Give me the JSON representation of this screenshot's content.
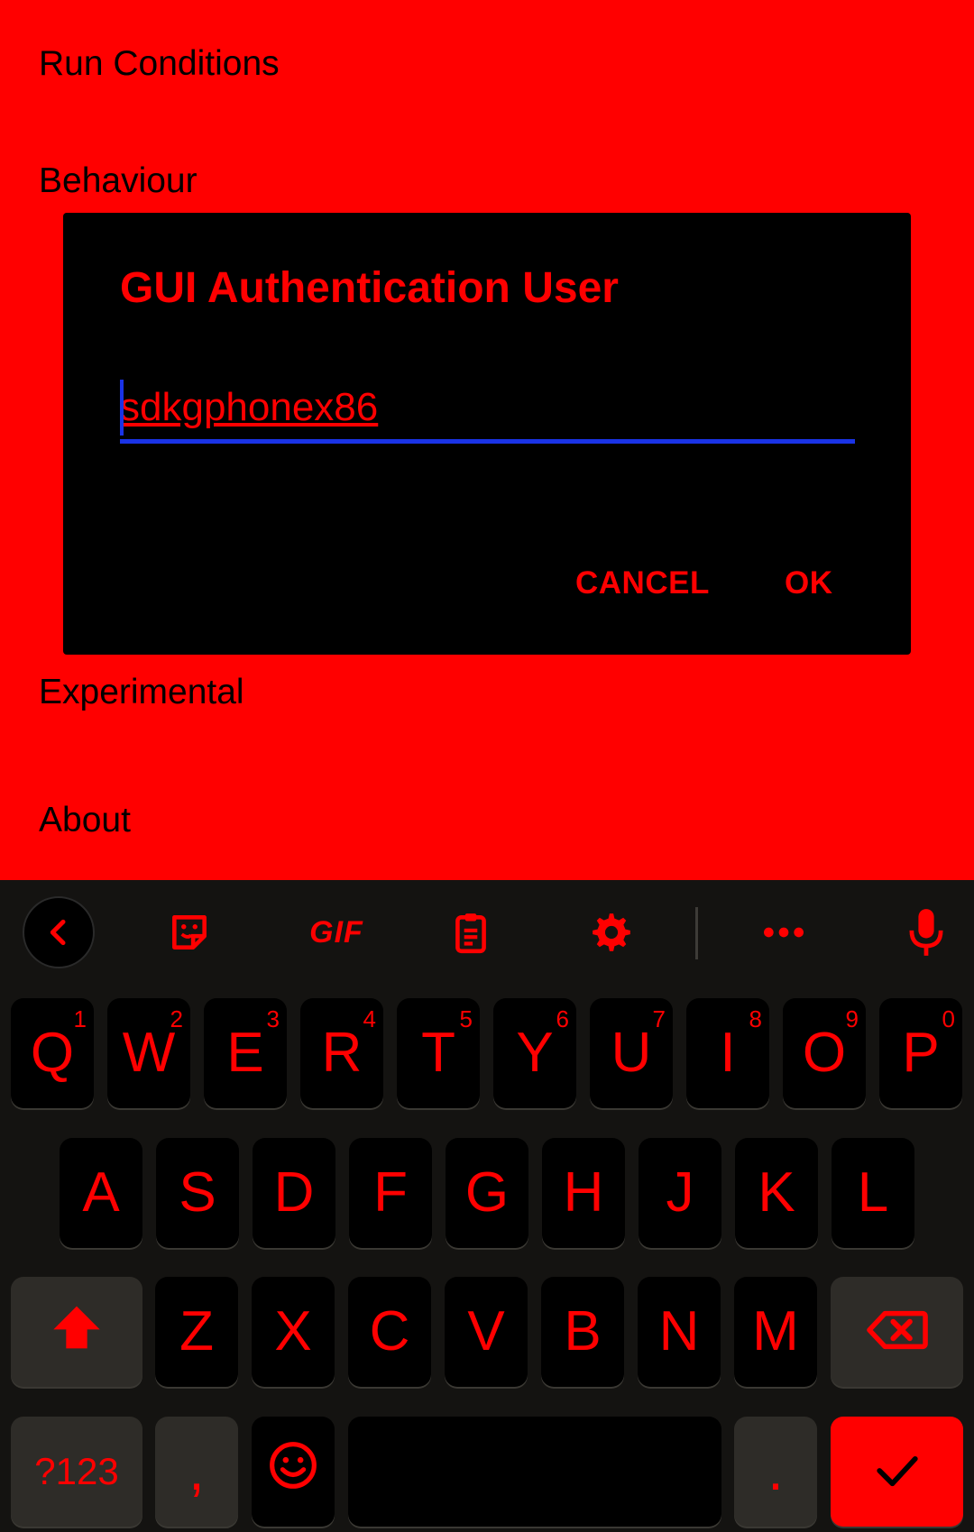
{
  "settings": {
    "items": [
      "Run Conditions",
      "Behaviour",
      "",
      "",
      "",
      "Experimental",
      "About"
    ]
  },
  "dialog": {
    "title": "GUI Authentication User",
    "field_value": "sdkgphonex86",
    "cancel_label": "CANCEL",
    "ok_label": "OK"
  },
  "keyboard": {
    "toolbar": {
      "gif_label": "GIF",
      "icons": [
        "back-icon",
        "sticker-icon",
        "gif-icon",
        "clipboard-icon",
        "gear-icon",
        "more-icon",
        "microphone-icon"
      ]
    },
    "row1": [
      {
        "label": "Q",
        "hint": "1"
      },
      {
        "label": "W",
        "hint": "2"
      },
      {
        "label": "E",
        "hint": "3"
      },
      {
        "label": "R",
        "hint": "4"
      },
      {
        "label": "T",
        "hint": "5"
      },
      {
        "label": "Y",
        "hint": "6"
      },
      {
        "label": "U",
        "hint": "7"
      },
      {
        "label": "I",
        "hint": "8"
      },
      {
        "label": "O",
        "hint": "9"
      },
      {
        "label": "P",
        "hint": "0"
      }
    ],
    "row2": [
      "A",
      "S",
      "D",
      "F",
      "G",
      "H",
      "J",
      "K",
      "L"
    ],
    "row3": [
      "Z",
      "X",
      "C",
      "V",
      "B",
      "N",
      "M"
    ],
    "row4": {
      "symbols": "?123",
      "comma": ",",
      "period": "."
    },
    "accent_color": "#ff0000"
  }
}
